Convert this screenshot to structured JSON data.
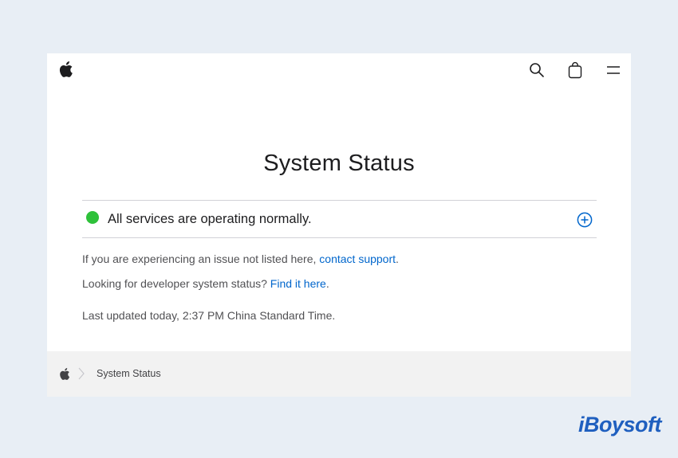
{
  "nav": {
    "logo_icon": "apple-logo-icon",
    "search_icon": "search-icon",
    "bag_icon": "shopping-bag-icon",
    "menu_icon": "menu-icon"
  },
  "page": {
    "title": "System Status"
  },
  "status": {
    "message": "All services are operating normally.",
    "indicator_color": "#2ec13a",
    "expand_icon": "plus-circle-icon"
  },
  "info": {
    "issue_prefix": "If you are experiencing an issue not listed here, ",
    "issue_link": "contact support",
    "issue_suffix": ".",
    "dev_prefix": "Looking for developer system status? ",
    "dev_link": "Find it here",
    "dev_suffix": ".",
    "last_updated": "Last updated today, 2:37 PM China Standard Time."
  },
  "footer": {
    "breadcrumb_icon": "apple-logo-icon",
    "breadcrumb_label": "System Status"
  },
  "watermark": {
    "text": "iBoysoft"
  },
  "colors": {
    "link": "#0066cc",
    "brand": "#1f5fbf",
    "background": "#e8eef5"
  }
}
